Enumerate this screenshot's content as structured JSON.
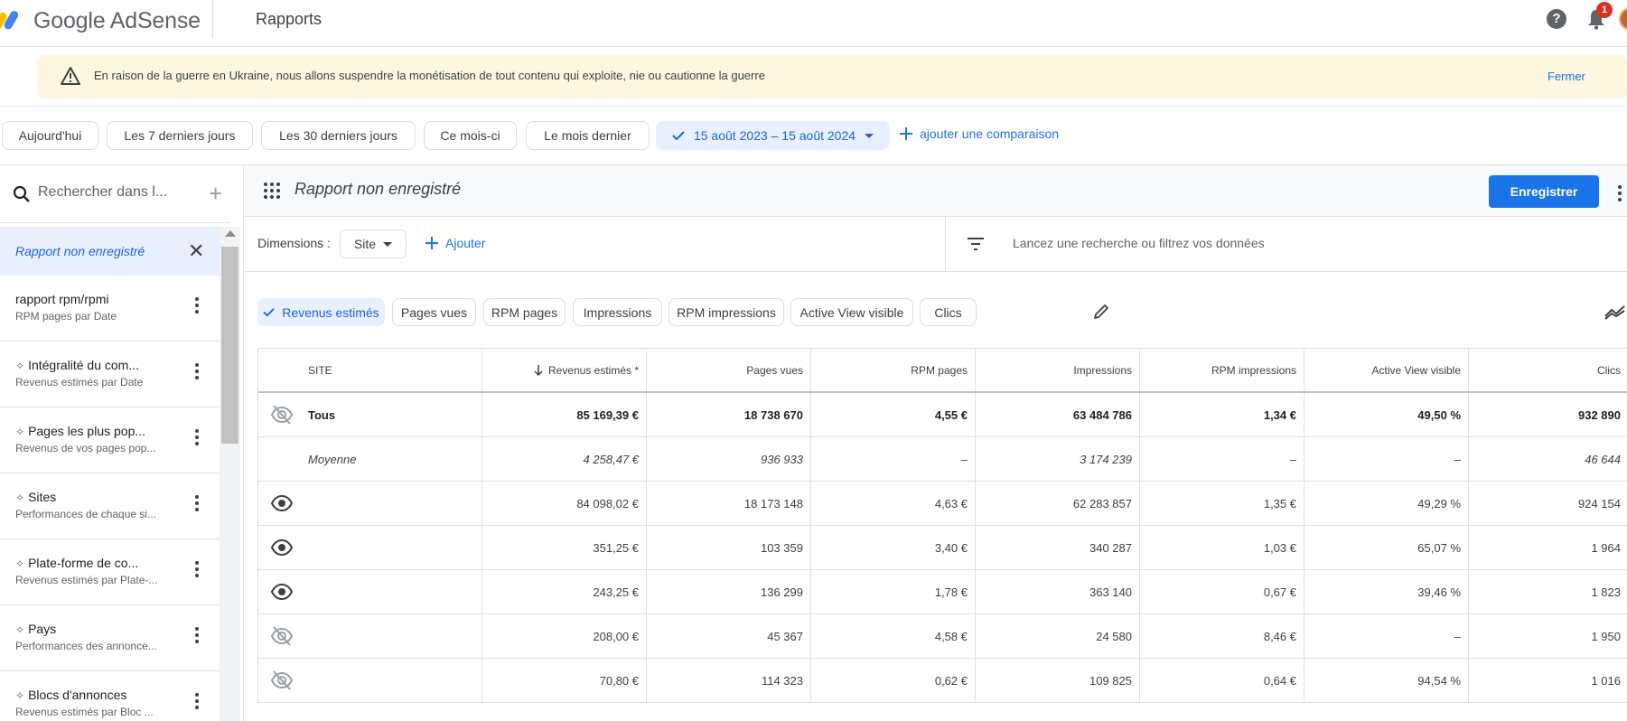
{
  "app": {
    "brand": "Google AdSense",
    "page_title": "Rapports"
  },
  "topbar": {
    "help_icon": "help-icon",
    "notification_count": "1"
  },
  "banner": {
    "text": "En raison de la guerre en Ukraine, nous allons suspendre la monétisation de tout contenu qui exploite, nie ou cautionne la guerre",
    "close_label": "Fermer"
  },
  "date_filters": [
    {
      "label": "Aujourd'hui",
      "selected": false
    },
    {
      "label": "Les 7 derniers jours",
      "selected": false
    },
    {
      "label": "Les 30 derniers jours",
      "selected": false
    },
    {
      "label": "Ce mois-ci",
      "selected": false
    },
    {
      "label": "Le mois dernier",
      "selected": false
    },
    {
      "label": "15 août 2023 – 15 août 2024",
      "selected": true
    }
  ],
  "add_comparison_label": "ajouter une comparaison",
  "sidebar": {
    "search_placeholder": "Rechercher dans l...",
    "active_item": "Rapport non enregistré",
    "items": [
      {
        "title": "rapport rpm/rpmi",
        "subtitle": "RPM pages par Date",
        "starred": false
      },
      {
        "title": "Intégralité du com...",
        "subtitle": "Revenus estimés par Date",
        "starred": true
      },
      {
        "title": "Pages les plus pop...",
        "subtitle": "Revenus de vos pages pop...",
        "starred": true
      },
      {
        "title": "Sites",
        "subtitle": "Performances de chaque si...",
        "starred": true
      },
      {
        "title": "Plate-forme de co...",
        "subtitle": "Revenus estimés par Plate-...",
        "starred": true
      },
      {
        "title": "Pays",
        "subtitle": "Performances des annonce...",
        "starred": true
      },
      {
        "title": "Blocs d'annonces",
        "subtitle": "Revenus estimés par Bloc ...",
        "starred": true
      }
    ]
  },
  "report": {
    "title": "Rapport non enregistré",
    "save_label": "Enregistrer",
    "dimensions_label": "Dimensions :",
    "dimension_value": "Site",
    "add_dimension_label": "Ajouter",
    "filter_placeholder": "Lancez une recherche ou filtrez vos données",
    "metrics": [
      {
        "label": "Revenus estimés",
        "selected": true
      },
      {
        "label": "Pages vues",
        "selected": false
      },
      {
        "label": "RPM pages",
        "selected": false
      },
      {
        "label": "Impressions",
        "selected": false
      },
      {
        "label": "RPM impressions",
        "selected": false
      },
      {
        "label": "Active View visible",
        "selected": false
      },
      {
        "label": "Clics",
        "selected": false
      }
    ]
  },
  "table": {
    "columns": [
      "SITE",
      "Revenus estimés *",
      "Pages vues",
      "RPM pages",
      "Impressions",
      "RPM impressions",
      "Active View visible",
      "Clics"
    ],
    "sort_column": "Revenus estimés *",
    "rows": [
      {
        "visibility": "hidden",
        "site": "Tous",
        "style": "bold",
        "values": [
          "85 169,39 €",
          "18 738 670",
          "4,55 €",
          "63 484 786",
          "1,34 €",
          "49,50 %",
          "932 890"
        ]
      },
      {
        "visibility": "none",
        "site": "Moyenne",
        "style": "italic",
        "values": [
          "4 258,47 €",
          "936 933",
          "–",
          "3 174 239",
          "–",
          "–",
          "46 644"
        ]
      },
      {
        "visibility": "visible",
        "site": "",
        "style": "normal",
        "values": [
          "84 098,02 €",
          "18 173 148",
          "4,63 €",
          "62 283 857",
          "1,35 €",
          "49,29 %",
          "924 154"
        ]
      },
      {
        "visibility": "visible",
        "site": "",
        "style": "normal",
        "values": [
          "351,25 €",
          "103 359",
          "3,40 €",
          "340 287",
          "1,03 €",
          "65,07 %",
          "1 964"
        ]
      },
      {
        "visibility": "visible",
        "site": "",
        "style": "normal",
        "values": [
          "243,25 €",
          "136 299",
          "1,78 €",
          "363 140",
          "0,67 €",
          "39,46 %",
          "1 823"
        ]
      },
      {
        "visibility": "hidden",
        "site": "",
        "style": "normal",
        "values": [
          "208,00 €",
          "45 367",
          "4,58 €",
          "24 580",
          "8,46 €",
          "–",
          "1 950"
        ]
      },
      {
        "visibility": "hidden",
        "site": "",
        "style": "normal",
        "values": [
          "70,80 €",
          "114 323",
          "0,62 €",
          "109 825",
          "0,64 €",
          "94,54 %",
          "1 016"
        ]
      }
    ]
  },
  "colors": {
    "accent": "#1a73e8",
    "banner_bg": "#fef7e0",
    "selected_chip_bg": "#e8f0fe"
  }
}
